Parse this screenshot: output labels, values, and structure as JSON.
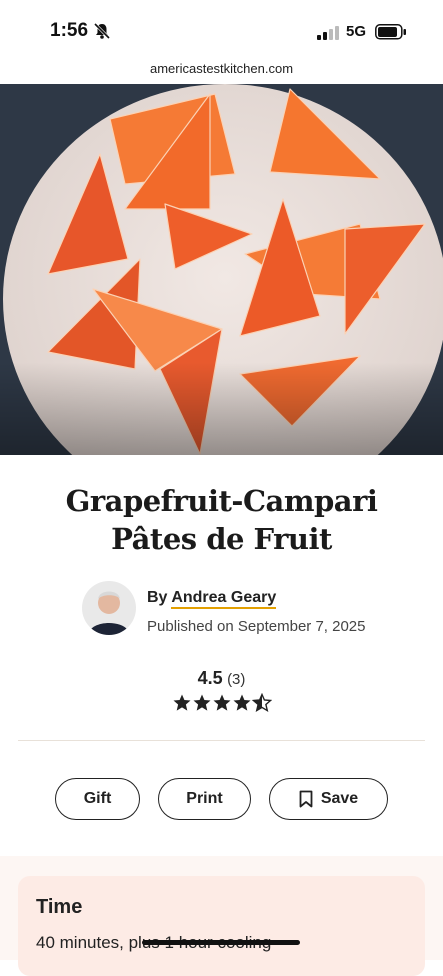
{
  "status": {
    "time": "1:56",
    "network": "5G",
    "icons": [
      "bell-muted-icon",
      "signal-icon",
      "battery-icon"
    ]
  },
  "browser": {
    "url": "americastestkitchen.com"
  },
  "hero": {
    "alt": "grapefruit-campari-pates-de-fruit-photo"
  },
  "recipe": {
    "title": "Grapefruit-Campari Pâtes de Fruit",
    "by_prefix": "By",
    "author": "Andrea Geary",
    "published": "Published on September 7, 2025"
  },
  "rating": {
    "score": "4.5",
    "count": "(3)",
    "stars": 4.5
  },
  "actions": {
    "gift": "Gift",
    "print": "Print",
    "save": "Save"
  },
  "time_card": {
    "label": "Time",
    "value": "40 minutes, plus 1 hour cooling"
  },
  "colors": {
    "accent_underline": "#e3a000",
    "card_bg": "#fdebe5",
    "plate": "#ece3df",
    "fruit": "#f2682c"
  }
}
